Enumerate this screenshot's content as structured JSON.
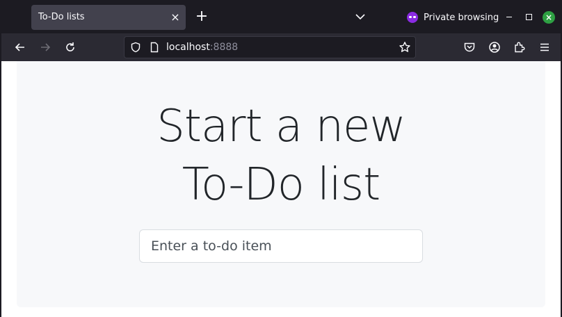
{
  "browser": {
    "tab_title": "To-Do lists",
    "private_label": "Private browsing",
    "url_host": "localhost",
    "url_port": ":8888"
  },
  "page": {
    "heading_line1": "Start a new",
    "heading_line2": "To-Do list",
    "input_placeholder": "Enter a to-do item"
  },
  "colors": {
    "private_accent": "#8a2be2",
    "window_close": "#2ea043",
    "jumbotron_bg": "#f7f8fa",
    "text_dark": "#212529"
  }
}
